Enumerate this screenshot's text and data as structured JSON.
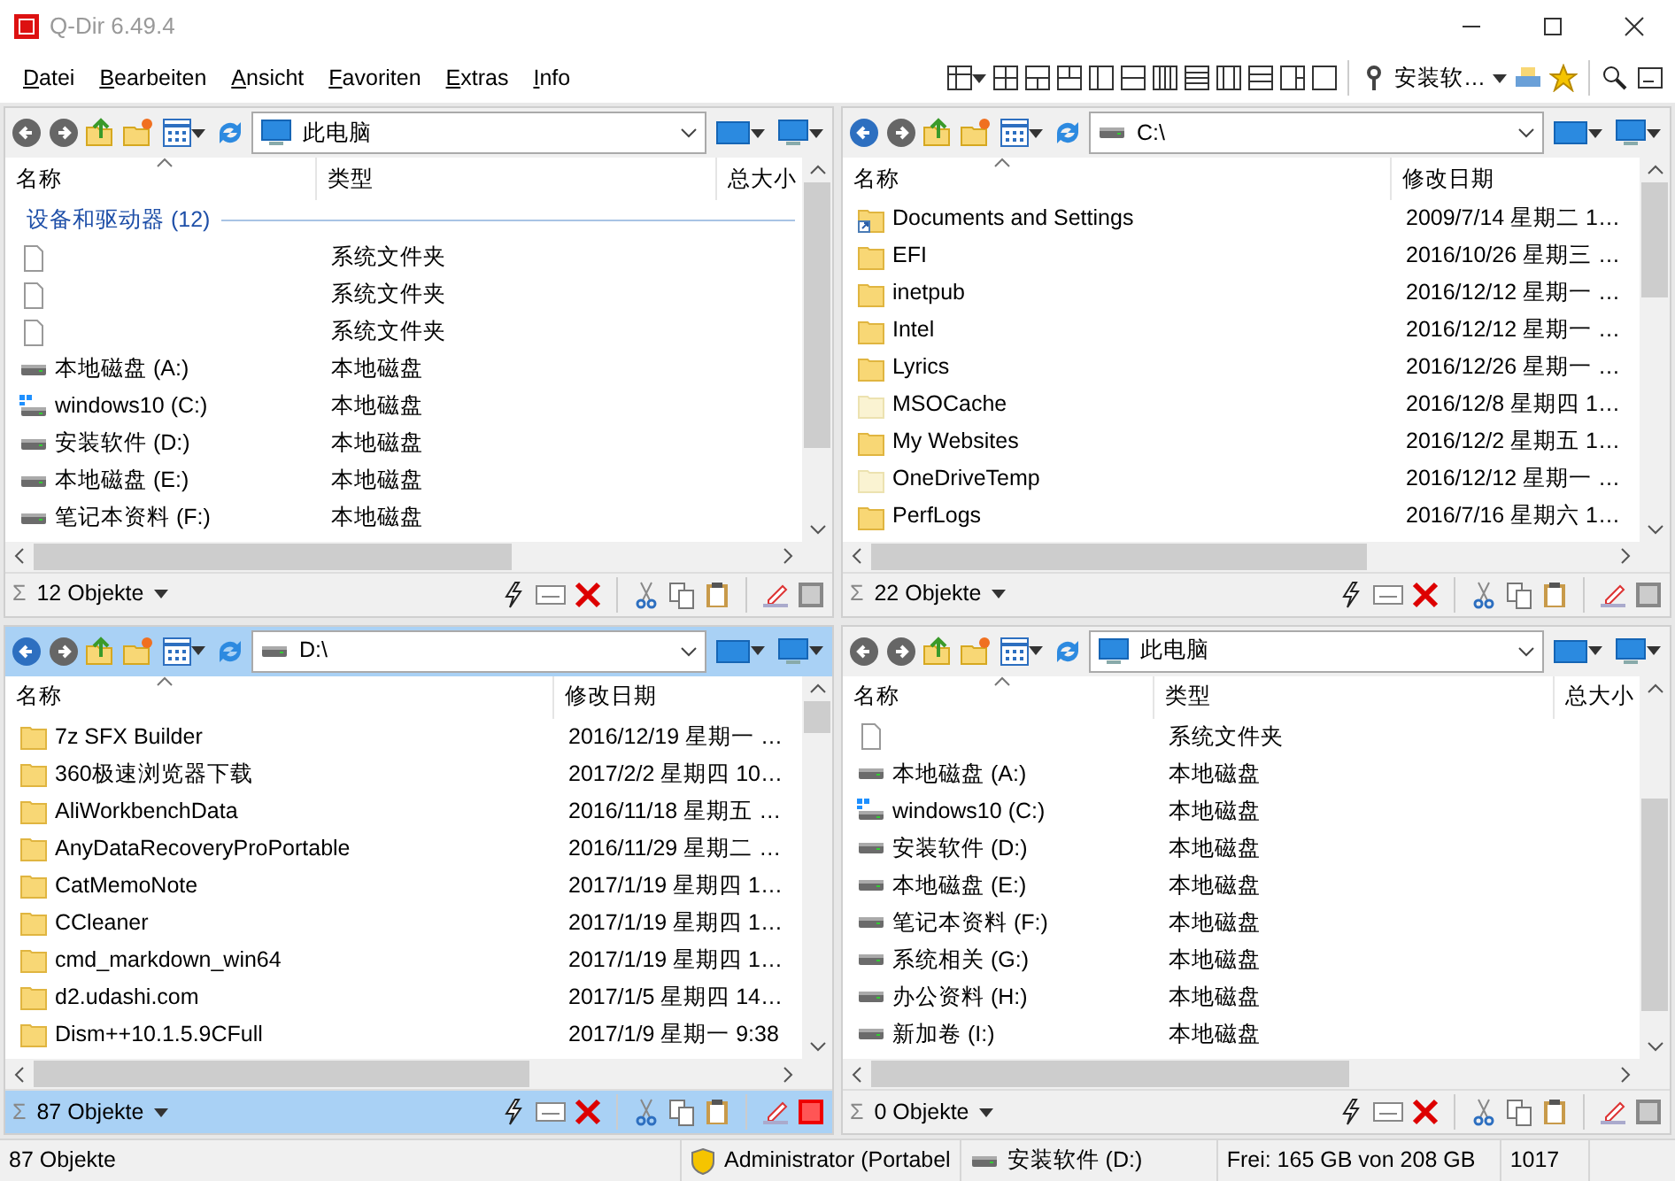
{
  "window": {
    "title": "Q-Dir 6.49.4"
  },
  "menu": [
    "Datei",
    "Bearbeiten",
    "Ansicht",
    "Favoriten",
    "Extras",
    "Info"
  ],
  "toolbar": {
    "drive_menu": "安装软…"
  },
  "panes": [
    {
      "active": false,
      "address": {
        "kind": "computer",
        "text": "此电脑"
      },
      "columns": [
        "名称",
        "类型",
        "总大小"
      ],
      "group": "设备和驱动器 (12)",
      "rows": [
        {
          "kind": "file",
          "name": "",
          "col2": "系统文件夹"
        },
        {
          "kind": "file",
          "name": "",
          "col2": "系统文件夹"
        },
        {
          "kind": "file",
          "name": "",
          "col2": "系统文件夹"
        },
        {
          "kind": "drive",
          "name": "本地磁盘 (A:)",
          "col2": "本地磁盘"
        },
        {
          "kind": "windows-drive",
          "name": "windows10 (C:)",
          "col2": "本地磁盘"
        },
        {
          "kind": "drive",
          "name": "安装软件 (D:)",
          "col2": "本地磁盘"
        },
        {
          "kind": "drive",
          "name": "本地磁盘 (E:)",
          "col2": "本地磁盘"
        },
        {
          "kind": "drive",
          "name": "笔记本资料 (F:)",
          "col2": "本地磁盘"
        }
      ],
      "count": "12 Objekte",
      "summary_symbol": "Σ"
    },
    {
      "active": false,
      "address": {
        "kind": "drive",
        "text": "C:\\"
      },
      "columns": [
        "名称",
        "修改日期"
      ],
      "rows": [
        {
          "kind": "shortcut-folder",
          "name": "Documents and Settings",
          "col2": "2009/7/14 星期二 1…"
        },
        {
          "kind": "folder",
          "name": "EFI",
          "col2": "2016/10/26 星期三 …"
        },
        {
          "kind": "folder",
          "name": "inetpub",
          "col2": "2016/12/12 星期一 …"
        },
        {
          "kind": "folder",
          "name": "Intel",
          "col2": "2016/12/12 星期一 …"
        },
        {
          "kind": "folder",
          "name": "Lyrics",
          "col2": "2016/12/26 星期一 …"
        },
        {
          "kind": "hidden-folder",
          "name": "MSOCache",
          "col2": "2016/12/8 星期四 1…"
        },
        {
          "kind": "folder",
          "name": "My Websites",
          "col2": "2016/12/2 星期五 1…"
        },
        {
          "kind": "hidden-folder",
          "name": "OneDriveTemp",
          "col2": "2016/12/12 星期一 …"
        },
        {
          "kind": "folder",
          "name": "PerfLogs",
          "col2": "2016/7/16 星期六 1…"
        }
      ],
      "count": "22 Objekte",
      "summary_symbol": "Σ"
    },
    {
      "active": true,
      "address": {
        "kind": "drive",
        "text": "D:\\"
      },
      "columns": [
        "名称",
        "修改日期"
      ],
      "rows": [
        {
          "kind": "folder",
          "name": "7z SFX Builder",
          "col2": "2016/12/19 星期一 …"
        },
        {
          "kind": "folder",
          "name": "360极速浏览器下载",
          "col2": "2017/2/2 星期四 10…"
        },
        {
          "kind": "folder",
          "name": "AliWorkbenchData",
          "col2": "2016/11/18 星期五 …"
        },
        {
          "kind": "folder",
          "name": "AnyDataRecoveryProPortable",
          "col2": "2016/11/29 星期二 …"
        },
        {
          "kind": "folder",
          "name": "CatMemoNote",
          "col2": "2017/1/19 星期四 1…"
        },
        {
          "kind": "folder",
          "name": "CCleaner",
          "col2": "2017/1/19 星期四 1…"
        },
        {
          "kind": "folder",
          "name": "cmd_markdown_win64",
          "col2": "2017/1/19 星期四 1…"
        },
        {
          "kind": "folder",
          "name": "d2.udashi.com",
          "col2": "2017/1/5 星期四 14…"
        },
        {
          "kind": "folder",
          "name": "Dism++10.1.5.9CFull",
          "col2": "2017/1/9 星期一 9:38"
        }
      ],
      "count": "87 Objekte",
      "summary_symbol": "Σ"
    },
    {
      "active": false,
      "address": {
        "kind": "computer",
        "text": "此电脑"
      },
      "columns": [
        "名称",
        "类型",
        "总大小"
      ],
      "rows": [
        {
          "kind": "file",
          "name": "",
          "col2": "系统文件夹"
        },
        {
          "kind": "drive",
          "name": "本地磁盘 (A:)",
          "col2": "本地磁盘"
        },
        {
          "kind": "windows-drive",
          "name": "windows10 (C:)",
          "col2": "本地磁盘"
        },
        {
          "kind": "drive",
          "name": "安装软件 (D:)",
          "col2": "本地磁盘"
        },
        {
          "kind": "drive",
          "name": "本地磁盘 (E:)",
          "col2": "本地磁盘"
        },
        {
          "kind": "drive",
          "name": "笔记本资料 (F:)",
          "col2": "本地磁盘"
        },
        {
          "kind": "drive",
          "name": "系统相关 (G:)",
          "col2": "本地磁盘"
        },
        {
          "kind": "drive",
          "name": "办公资料 (H:)",
          "col2": "本地磁盘"
        },
        {
          "kind": "drive",
          "name": "新加卷 (I:)",
          "col2": "本地磁盘"
        }
      ],
      "count": "0 Objekte",
      "summary_symbol": "Σ"
    }
  ],
  "status_bar": {
    "count": "87 Objekte",
    "user": "Administrator (Portabel",
    "drive": "安装软件 (D:)",
    "free": "Frei: 165 GB von 208 GB",
    "number": "1017"
  }
}
